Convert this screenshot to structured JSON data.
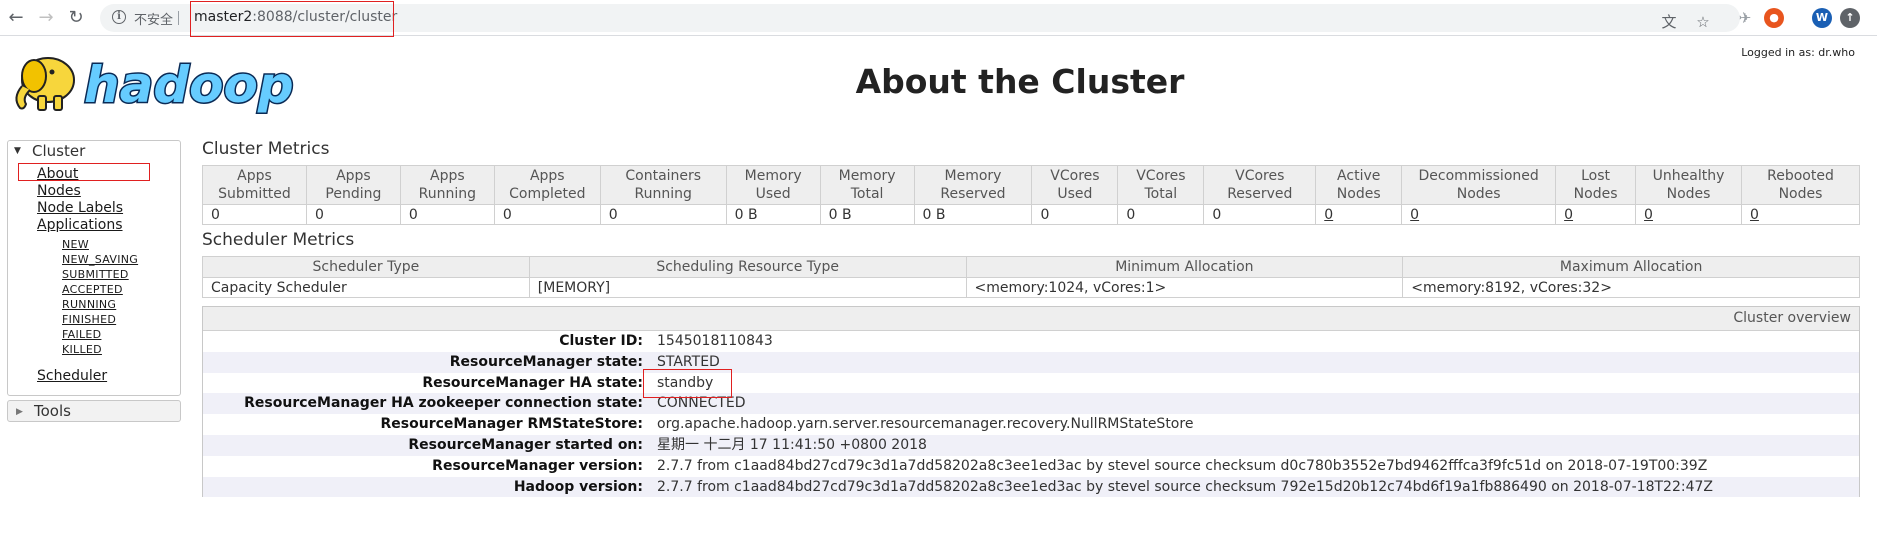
{
  "browser": {
    "security_label": "不安全",
    "url_host": "master2",
    "url_rest": ":8088/cluster/cluster",
    "profile_initial": "W"
  },
  "header": {
    "logged_in": "Logged in as: dr.who",
    "title": "About the Cluster",
    "logo_text": "hadoop"
  },
  "sidebar": {
    "cluster_label": "Cluster",
    "links": [
      "About",
      "Nodes",
      "Node Labels",
      "Applications"
    ],
    "app_states": [
      "NEW",
      "NEW_SAVING",
      "SUBMITTED",
      "ACCEPTED",
      "RUNNING",
      "FINISHED",
      "FAILED",
      "KILLED"
    ],
    "scheduler": "Scheduler",
    "tools_label": "Tools"
  },
  "cluster_metrics": {
    "title": "Cluster Metrics",
    "headers": [
      [
        "Apps",
        "Submitted"
      ],
      [
        "Apps",
        "Pending"
      ],
      [
        "Apps",
        "Running"
      ],
      [
        "Apps",
        "Completed"
      ],
      [
        "Containers",
        "Running"
      ],
      [
        "Memory",
        "Used"
      ],
      [
        "Memory",
        "Total"
      ],
      [
        "Memory",
        "Reserved"
      ],
      [
        "VCores",
        "Used"
      ],
      [
        "VCores",
        "Total"
      ],
      [
        "VCores",
        "Reserved"
      ],
      [
        "Active",
        "Nodes"
      ],
      [
        "Decommissioned",
        "Nodes"
      ],
      [
        "Lost",
        "Nodes"
      ],
      [
        "Unhealthy",
        "Nodes"
      ],
      [
        "Rebooted",
        "Nodes"
      ]
    ],
    "values": [
      "0",
      "0",
      "0",
      "0",
      "0",
      "0 B",
      "0 B",
      "0 B",
      "0",
      "0",
      "0",
      "0",
      "0",
      "0",
      "0",
      "0"
    ]
  },
  "scheduler_metrics": {
    "title": "Scheduler Metrics",
    "headers": [
      "Scheduler Type",
      "Scheduling Resource Type",
      "Minimum Allocation",
      "Maximum Allocation"
    ],
    "values": [
      "Capacity Scheduler",
      "[MEMORY]",
      "<memory:1024, vCores:1>",
      "<memory:8192, vCores:32>"
    ]
  },
  "overview": {
    "title": "Cluster overview",
    "rows": [
      {
        "label": "Cluster ID:",
        "value": "1545018110843"
      },
      {
        "label": "ResourceManager state:",
        "value": "STARTED"
      },
      {
        "label": "ResourceManager HA state:",
        "value": "standby"
      },
      {
        "label": "ResourceManager HA zookeeper connection state:",
        "value": "CONNECTED"
      },
      {
        "label": "ResourceManager RMStateStore:",
        "value": "org.apache.hadoop.yarn.server.resourcemanager.recovery.NullRMStateStore"
      },
      {
        "label": "ResourceManager started on:",
        "value": "星期一 十二月 17 11:41:50 +0800 2018"
      },
      {
        "label": "ResourceManager version:",
        "value": "2.7.7 from c1aad84bd27cd79c3d1a7dd58202a8c3ee1ed3ac by stevel source checksum d0c780b3552e7bd9462fffca3f9fc51d on 2018-07-19T00:39Z"
      },
      {
        "label": "Hadoop version:",
        "value": "2.7.7 from c1aad84bd27cd79c3d1a7dd58202a8c3ee1ed3ac by stevel source checksum 792e15d20b12c74bd6f19a1fb886490 on 2018-07-18T22:47Z"
      }
    ]
  },
  "colors": {
    "highlight_box": "#e02020",
    "table_header_bg": "#eeeeee",
    "row_alt_bg": "#f0f0f8",
    "logo_yellow": "#f7d63c",
    "logo_blue": "#66ccff"
  }
}
